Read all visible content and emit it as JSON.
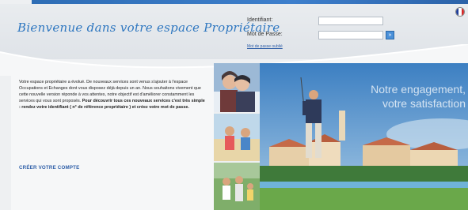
{
  "header": {
    "welcome": "Bienvenue dans votre espace Propriétaire"
  },
  "login": {
    "identifier_label": "Identifiant:",
    "password_label": "Mot de Passe:",
    "submit_label": "»",
    "forgot_link": "Mot de passe oublié"
  },
  "language": {
    "flag_icon": "french-flag-icon"
  },
  "intro": {
    "p1": "Votre espace propriétaire a évolué. De nouveaux services sont venus s'ajouter à l'espace Occupations et Echanges dont vous disposez déjà depuis un an. Nous souhaitons vivement que cette nouvelle version réponde à vos attentes, notre objectif est d'améliorer constamment les services qui vous sont proposés. ",
    "p2_bold": "Pour découvrir tous ces nouveaux services c'est très simple : rendez votre identifiant ( n° de référence propriétaire ) et créez votre mot de passe."
  },
  "create_account": "CRÉER VOTRE COMPTE",
  "slogan": {
    "line1": "Notre engagement,",
    "line2": "votre satisfaction"
  },
  "colors": {
    "accent": "#2f77c0",
    "link": "#2f5fa8",
    "top_bar": "#2e6db5"
  }
}
